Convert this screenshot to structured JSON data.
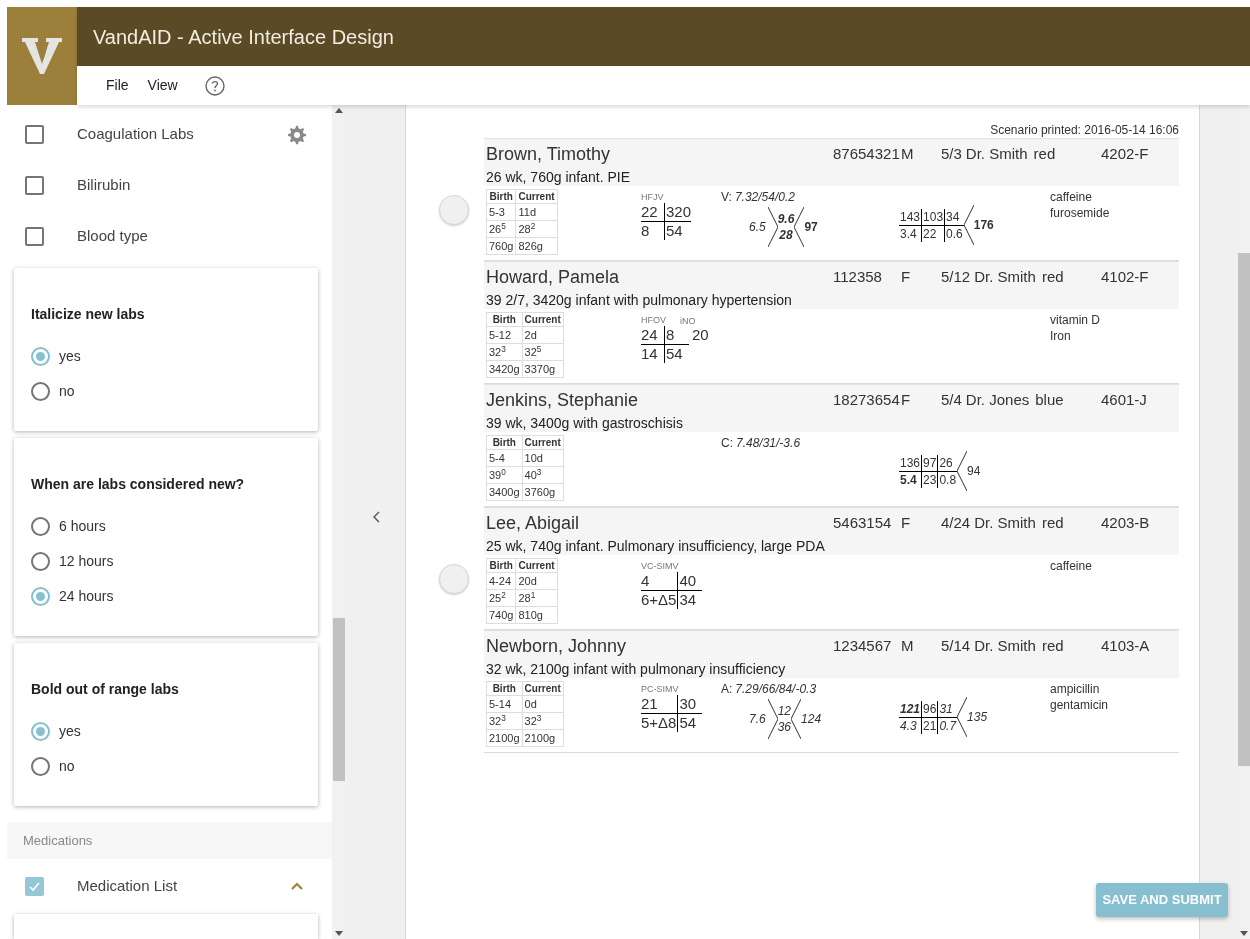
{
  "app": {
    "title": "VandAID - Active Interface Design",
    "menu": [
      "File",
      "View"
    ]
  },
  "sidebar": {
    "items": [
      {
        "label": "Coagulation Labs",
        "checked": false,
        "settings": true
      },
      {
        "label": "Bilirubin",
        "checked": false,
        "settings": false
      },
      {
        "label": "Blood type",
        "checked": false,
        "settings": false
      }
    ],
    "cards": [
      {
        "title": "Italicize new labs",
        "options": [
          {
            "label": "yes",
            "selected": true
          },
          {
            "label": "no",
            "selected": false
          }
        ]
      },
      {
        "title": "When are labs considered new?",
        "options": [
          {
            "label": "6 hours",
            "selected": false
          },
          {
            "label": "12 hours",
            "selected": false
          },
          {
            "label": "24 hours",
            "selected": true
          }
        ]
      },
      {
        "title": "Bold out of range labs",
        "options": [
          {
            "label": "yes",
            "selected": true
          },
          {
            "label": "no",
            "selected": false
          }
        ]
      }
    ],
    "section": "Medications",
    "med_item": {
      "label": "Medication List",
      "checked": true,
      "expanded": true
    }
  },
  "scenario_printed": "Scenario printed: 2016-05-14 16:06",
  "patients": [
    {
      "name": "Brown, Timothy",
      "mrn": "87654321",
      "sex": "M",
      "admit": "5/3",
      "doctor": "Dr. Smith",
      "team": "red",
      "bed": "4202-F",
      "summary": "26 wk, 760g infant. PIE",
      "marker": true,
      "growth": {
        "headers": [
          "Birth",
          "Current"
        ],
        "rows": [
          [
            "5-3",
            "11d"
          ],
          [
            "26$^{5}$",
            "28$^{2}$"
          ],
          [
            "760g",
            "826g"
          ]
        ]
      },
      "vent": {
        "mode": "HFJV",
        "cells": [
          "22",
          "320",
          "8",
          "54"
        ]
      },
      "gas": {
        "label": "V:",
        "value": "7.32/54/0.2"
      },
      "cbc": {
        "left": {
          "v": "6.5",
          "bold": false,
          "italic": true
        },
        "top": {
          "v": "9.6",
          "bold": true,
          "italic": true
        },
        "bottom": {
          "v": "28",
          "bold": true,
          "italic": true
        },
        "right": {
          "v": "97",
          "bold": true,
          "italic": false
        }
      },
      "bmp": {
        "cells": [
          {
            "v": "143",
            "bold": false,
            "italic": false
          },
          {
            "v": "103",
            "bold": false,
            "italic": false
          },
          {
            "v": "34",
            "bold": false,
            "italic": false
          },
          {
            "v": "3.4",
            "bold": false,
            "italic": false
          },
          {
            "v": "22",
            "bold": false,
            "italic": false
          },
          {
            "v": "0.6",
            "bold": false,
            "italic": false
          }
        ],
        "right": {
          "v": "176",
          "bold": true,
          "italic": false
        }
      },
      "meds": [
        "caffeine",
        "furosemide"
      ]
    },
    {
      "name": "Howard, Pamela",
      "mrn": "112358",
      "sex": "F",
      "admit": "5/12",
      "doctor": "Dr. Smith",
      "team": "red",
      "bed": "4102-F",
      "summary": "39 2/7, 3420g infant with pulmonary hypertension",
      "marker": false,
      "growth": {
        "headers": [
          "Birth",
          "Current"
        ],
        "rows": [
          [
            "5-12",
            "2d"
          ],
          [
            "32$^{3}$",
            "32$^{5}$"
          ],
          [
            "3420g",
            "3370g"
          ]
        ]
      },
      "vent": {
        "mode": "HFOV",
        "cells": [
          "24",
          "8",
          "14",
          "54"
        ],
        "extra": {
          "label": "iNO",
          "value": "20"
        }
      },
      "meds": [
        "vitamin D",
        "Iron"
      ]
    },
    {
      "name": "Jenkins, Stephanie",
      "mrn": "18273654",
      "sex": "F",
      "admit": "5/4",
      "doctor": "Dr. Jones",
      "team": "blue",
      "bed": "4601-J",
      "summary": "39 wk, 3400g with gastroschisis",
      "marker": false,
      "growth": {
        "headers": [
          "Birth",
          "Current"
        ],
        "rows": [
          [
            "5-4",
            "10d"
          ],
          [
            "39$^{0}$",
            "40$^{3}$"
          ],
          [
            "3400g",
            "3760g"
          ]
        ]
      },
      "gas": {
        "label": "C:",
        "value": "7.48/31/-3.6"
      },
      "bmp": {
        "cells": [
          {
            "v": "136",
            "bold": false,
            "italic": false
          },
          {
            "v": "97",
            "bold": false,
            "italic": false
          },
          {
            "v": "26",
            "bold": false,
            "italic": false
          },
          {
            "v": "5.4",
            "bold": true,
            "italic": false
          },
          {
            "v": "23",
            "bold": false,
            "italic": false
          },
          {
            "v": "0.8",
            "bold": false,
            "italic": false
          }
        ],
        "right": {
          "v": "94",
          "bold": false,
          "italic": false
        }
      }
    },
    {
      "name": "Lee, Abigail",
      "mrn": "5463154",
      "sex": "F",
      "admit": "4/24",
      "doctor": "Dr. Smith",
      "team": "red",
      "bed": "4203-B",
      "summary": "25 wk, 740g infant. Pulmonary insufficiency, large PDA",
      "marker": true,
      "growth": {
        "headers": [
          "Birth",
          "Current"
        ],
        "rows": [
          [
            "4-24",
            "20d"
          ],
          [
            "25$^{2}$",
            "28$^{1}$"
          ],
          [
            "740g",
            "810g"
          ]
        ]
      },
      "vent": {
        "mode": "VC-SIMV",
        "cells": [
          "4",
          "40",
          "6+Δ5",
          "34"
        ]
      },
      "meds": [
        "caffeine"
      ]
    },
    {
      "name": "Newborn, Johnny",
      "mrn": "1234567",
      "sex": "M",
      "admit": "5/14",
      "doctor": "Dr. Smith",
      "team": "red",
      "bed": "4103-A",
      "summary": "32 wk, 2100g infant with pulmonary insufficiency",
      "marker": false,
      "growth": {
        "headers": [
          "Birth",
          "Current"
        ],
        "rows": [
          [
            "5-14",
            "0d"
          ],
          [
            "32$^{3}$",
            "32$^{3}$"
          ],
          [
            "2100g",
            "2100g"
          ]
        ]
      },
      "vent": {
        "mode": "PC-SIMV",
        "cells": [
          "21",
          "30",
          "5+Δ8",
          "54"
        ]
      },
      "gas": {
        "label": "A:",
        "value": "7.29/66/84/-0.3"
      },
      "cbc": {
        "left": {
          "v": "7.6",
          "bold": false,
          "italic": true
        },
        "top": {
          "v": "12",
          "bold": false,
          "italic": true
        },
        "bottom": {
          "v": "36",
          "bold": false,
          "italic": true
        },
        "right": {
          "v": "124",
          "bold": false,
          "italic": true
        }
      },
      "bmp": {
        "cells": [
          {
            "v": "121",
            "bold": true,
            "italic": true
          },
          {
            "v": "96",
            "bold": false,
            "italic": false
          },
          {
            "v": "31",
            "bold": false,
            "italic": true
          },
          {
            "v": "4.3",
            "bold": false,
            "italic": true
          },
          {
            "v": "21",
            "bold": false,
            "italic": false
          },
          {
            "v": "0.7",
            "bold": false,
            "italic": true
          }
        ],
        "right": {
          "v": "135",
          "bold": false,
          "italic": true
        }
      },
      "meds": [
        "ampicillin",
        "gentamicin"
      ]
    }
  ],
  "save_button": "SAVE AND SUBMIT"
}
